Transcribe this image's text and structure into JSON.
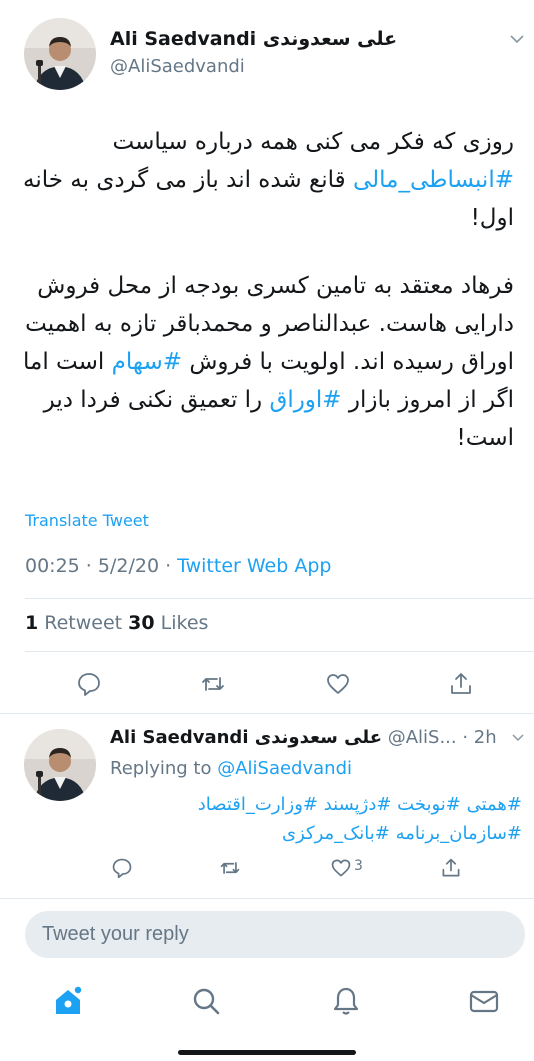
{
  "main_tweet": {
    "display_name": "Ali Saedvandi علی سعدوندی",
    "handle": "@AliSaedvandi",
    "paragraph1": [
      {
        "text": "روزی که فکر می کنی همه درباره سیاست ",
        "tag": false
      },
      {
        "text": "#انبساطی_مالی",
        "tag": true
      },
      {
        "text": " قانع شده اند باز می گردی به خانه اول!",
        "tag": false
      }
    ],
    "paragraph2": [
      {
        "text": "فرهاد معتقد به تامین کسری بودجه از محل فروش دارایی هاست. عبدالناصر و محمدباقر تازه به اهمیت اوراق رسیده اند. اولویت با فروش ",
        "tag": false
      },
      {
        "text": "#سهام",
        "tag": true
      },
      {
        "text": " است اما اگر از امروز بازار ",
        "tag": false
      },
      {
        "text": "#اوراق",
        "tag": true
      },
      {
        "text": " را تعمیق نکنی فردا دیر است!",
        "tag": false
      }
    ],
    "translate_label": "Translate Tweet",
    "time": "00:25 · 5/2/20 · ",
    "source_app": "Twitter Web App",
    "retweet_count": "1",
    "retweet_label": " Retweet  ",
    "like_count": "30",
    "like_label": " Likes"
  },
  "reply": {
    "display_name": "Ali Saedvandi علی سعدوندی",
    "handle_time": " @AliS... · 2h",
    "replying_prefix": "Replying to ",
    "replying_to": "@AliSaedvandi",
    "hashtags_line1": "#همتی #نوبخت #دژپسند #وزارت_اقتصاد",
    "hashtags_line2": "#سازمان_برنامه #بانک_مرکزی",
    "like_count": "3"
  },
  "composer": {
    "placeholder": "Tweet your reply"
  },
  "icons": {
    "chevron": "chevron-down-icon",
    "reply": "reply-icon",
    "retweet": "retweet-icon",
    "like": "heart-icon",
    "share": "share-icon",
    "home": "home-icon",
    "search": "search-icon",
    "notifications": "bell-icon",
    "messages": "mail-icon"
  },
  "colors": {
    "accent": "#1da1f2",
    "text": "#14171a",
    "muted": "#657786",
    "divider": "#e1e8ed"
  }
}
